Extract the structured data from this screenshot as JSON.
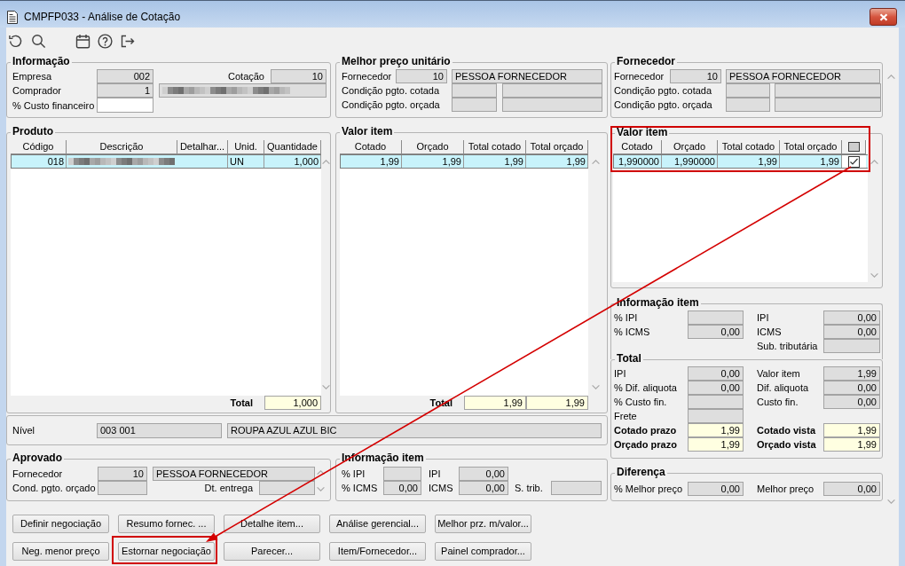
{
  "window": {
    "title": "CMPFP033 - Análise de Cotação"
  },
  "informacao": {
    "title": "Informação",
    "empresa": {
      "label": "Empresa",
      "value": "002",
      "kind": "readonly"
    },
    "cotacao": {
      "label": "Cotação",
      "value": "10",
      "kind": "readonly"
    },
    "comprador": {
      "label": "Comprador",
      "value": "1",
      "kind": "readonly",
      "name_blurred": true
    },
    "custo_financeiro": {
      "label": "% Custo financeiro",
      "kind": "input"
    }
  },
  "melhor_preco": {
    "title": "Melhor preço unitário",
    "fornecedor": {
      "label": "Fornecedor",
      "code": "10",
      "name": "PESSOA FORNECEDOR"
    },
    "cond_cotada": {
      "label": "Condição pgto. cotada"
    },
    "cond_orcada": {
      "label": "Condição pgto. orçada"
    }
  },
  "fornecedor": {
    "title": "Fornecedor",
    "fornecedor": {
      "label": "Fornecedor",
      "code": "10",
      "name": "PESSOA FORNECEDOR"
    },
    "cond_cotada": {
      "label": "Condição pgto. cotada"
    },
    "cond_orcada": {
      "label": "Condição pgto. orçada"
    }
  },
  "produto": {
    "title": "Produto",
    "columns": [
      "Código",
      "Descrição",
      "Detalhar...",
      "Unid.",
      "Quantidade"
    ],
    "rows": [
      {
        "codigo": "018",
        "descricao_blurred": true,
        "unidade": "UN",
        "quantidade": "1,000",
        "selected": true
      }
    ],
    "total": {
      "label": "Total",
      "value": "1,000"
    }
  },
  "valor_item": {
    "title": "Valor item",
    "columns": [
      "Cotado",
      "Orçado",
      "Total cotado",
      "Total orçado"
    ],
    "rows": [
      {
        "cells": [
          "1,99",
          "1,99",
          "1,99",
          "1,99"
        ],
        "selected": true
      }
    ],
    "total": {
      "label": "Total",
      "values": [
        "1,99",
        "1,99"
      ]
    }
  },
  "fornecedor_valor_item": {
    "title": "Valor item",
    "highlighted": true,
    "columns": [
      "Cotado",
      "Orçado",
      "Total cotado",
      "Total orçado"
    ],
    "rows": [
      {
        "cells": [
          "1,990000",
          "1,990000",
          "1,99",
          "1,99"
        ],
        "checked": true,
        "selected": true
      }
    ]
  },
  "informacao_item": {
    "title": "Informação item",
    "rows": [
      {
        "left": {
          "label": "% IPI",
          "kind": "readonly"
        },
        "right": {
          "label": "IPI",
          "value": "0,00",
          "kind": "readonly"
        }
      },
      {
        "left": {
          "label": "% ICMS",
          "value": "0,00",
          "kind": "readonly"
        },
        "right": {
          "label": "ICMS",
          "value": "0,00",
          "kind": "readonly"
        }
      },
      {
        "right": {
          "label": "Sub. tributária",
          "kind": "readonly"
        }
      }
    ]
  },
  "total": {
    "title": "Total",
    "rows": [
      {
        "left": {
          "label": "IPI",
          "value": "0,00",
          "kind": "readonly"
        },
        "right": {
          "label": "Valor item",
          "value": "1,99",
          "kind": "readonly"
        }
      },
      {
        "left": {
          "label": "% Dif. aliquota",
          "value": "0,00",
          "kind": "readonly"
        },
        "right": {
          "label": "Dif. aliquota",
          "value": "0,00",
          "kind": "readonly"
        }
      },
      {
        "left": {
          "label": "% Custo fin.",
          "kind": "readonly"
        },
        "right": {
          "label": "Custo fin.",
          "value": "0,00",
          "kind": "readonly"
        }
      },
      {
        "left": {
          "label": "Frete",
          "kind": "readonly"
        }
      },
      {
        "left": {
          "label": "Cotado prazo",
          "value": "1,99",
          "kind": "total"
        },
        "right": {
          "label": "Cotado vista",
          "value": "1,99",
          "kind": "total"
        }
      },
      {
        "left": {
          "label": "Orçado prazo",
          "value": "1,99",
          "kind": "total"
        },
        "right": {
          "label": "Orçado vista",
          "value": "1,99",
          "kind": "total"
        }
      }
    ]
  },
  "diferenca": {
    "title": "Diferença",
    "rows": [
      {
        "left": {
          "label": "% Melhor preço",
          "value": "0,00",
          "kind": "readonly"
        },
        "right": {
          "label": "Melhor preço",
          "value": "0,00",
          "kind": "readonly"
        }
      }
    ]
  },
  "nivel": {
    "label": "Nível",
    "code": "003 001",
    "description": "ROUPA AZUL AZUL BIC"
  },
  "aprovado": {
    "title": "Aprovado",
    "fornecedor": {
      "label": "Fornecedor",
      "code": "10",
      "name": "PESSOA FORNECEDOR"
    },
    "cond_orcado": {
      "label": "Cond. pgto. orçado"
    },
    "dt_entrega": {
      "label": "Dt. entrega"
    }
  },
  "aprovado_informacao_item": {
    "title": "Informação item",
    "rows": [
      [
        {
          "label": "% IPI",
          "kind": "readonly"
        },
        {
          "label": "IPI",
          "value": "0,00",
          "kind": "readonly"
        }
      ],
      [
        {
          "label": "% ICMS",
          "value": "0,00",
          "kind": "readonly"
        },
        {
          "label": "ICMS",
          "value": "0,00",
          "kind": "readonly"
        },
        {
          "label": "S. trib.",
          "kind": "readonly"
        }
      ]
    ]
  },
  "buttons": [
    [
      {
        "label": "Definir negociação",
        "highlighted": false
      },
      {
        "label": "Resumo fornec. ...",
        "highlighted": false
      },
      {
        "label": "Detalhe item...",
        "highlighted": false
      },
      {
        "label": "Análise gerencial...",
        "highlighted": false
      },
      {
        "label": "Melhor prz. m/valor...",
        "highlighted": false
      }
    ],
    [
      {
        "label": "Neg. menor preço",
        "highlighted": false
      },
      {
        "label": "Estornar negociação",
        "highlighted": true
      },
      {
        "label": "Parecer...",
        "highlighted": false
      },
      {
        "label": "Item/Fornecedor...",
        "highlighted": false
      },
      {
        "label": "Painel comprador...",
        "highlighted": false
      }
    ]
  ],
  "callout_arrow": true
}
